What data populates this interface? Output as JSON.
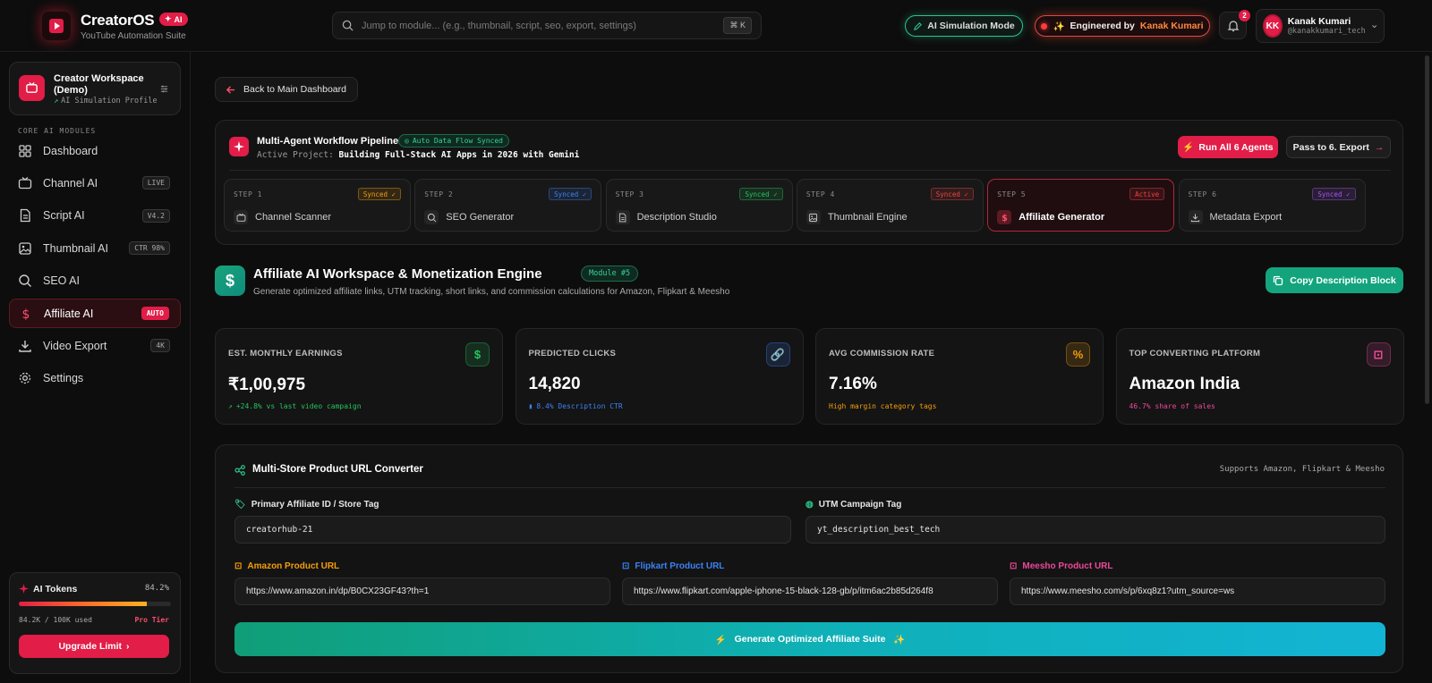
{
  "brand": {
    "title": "CreatorOS",
    "badge": "AI",
    "subtitle": "YouTube Automation Suite"
  },
  "search": {
    "placeholder": "Jump to module... (e.g., thumbnail, script, seo, export, settings)",
    "shortcut": "⌘ K"
  },
  "header": {
    "sim_mode": "AI Simulation Mode",
    "engineered_prefix": "Engineered by",
    "engineered_name": "Kanak Kumari",
    "notif_count": "2"
  },
  "user": {
    "name": "Kanak Kumari",
    "handle": "@kanakkumari_tech",
    "initials": "KK"
  },
  "workspace": {
    "name": "Creator Workspace (Demo)",
    "profile": "AI Simulation Profile"
  },
  "sidebar": {
    "section_label": "CORE AI MODULES",
    "items": [
      {
        "label": "Dashboard",
        "tag": "",
        "icon": "grid-icon"
      },
      {
        "label": "Channel AI",
        "tag": "LIVE",
        "icon": "tv-icon"
      },
      {
        "label": "Script AI",
        "tag": "V4.2",
        "icon": "document-icon"
      },
      {
        "label": "Thumbnail AI",
        "tag": "CTR 98%",
        "icon": "image-icon"
      },
      {
        "label": "SEO AI",
        "tag": "",
        "icon": "search-icon"
      },
      {
        "label": "Affiliate AI",
        "tag": "AUTO",
        "icon": "dollar-icon",
        "active": true
      },
      {
        "label": "Video Export",
        "tag": "4K",
        "icon": "download-icon"
      },
      {
        "label": "Settings",
        "tag": "",
        "icon": "gear-icon"
      }
    ]
  },
  "tokens": {
    "title": "AI Tokens",
    "percent_label": "84.2%",
    "percent": 84.2,
    "used": "84.2K / 100K used",
    "tier": "Pro Tier",
    "upgrade": "Upgrade Limit"
  },
  "back_label": "Back to Main Dashboard",
  "pipeline": {
    "title": "Multi-Agent Workflow Pipeline",
    "flow_badge": "Auto Data Flow Synced",
    "project_prefix": "Active Project:",
    "project": "Building Full-Stack AI Apps in 2026 with Gemini",
    "run_all": "Run All 6 Agents",
    "pass_to": "Pass to 6. Export",
    "steps": [
      {
        "num": "STEP 1",
        "status": "Synced ✓",
        "label": "Channel Scanner",
        "color": "#f59e0b"
      },
      {
        "num": "STEP 2",
        "status": "Synced ✓",
        "label": "SEO Generator",
        "color": "#3b82f6"
      },
      {
        "num": "STEP 3",
        "status": "Synced ✓",
        "label": "Description Studio",
        "color": "#22c55e"
      },
      {
        "num": "STEP 4",
        "status": "Synced ✓",
        "label": "Thumbnail Engine",
        "color": "#ef4444"
      },
      {
        "num": "STEP 5",
        "status": "Active",
        "label": "Affiliate Generator",
        "color": "#ef4444",
        "active": true
      },
      {
        "num": "STEP 6",
        "status": "Synced ✓",
        "label": "Metadata Export",
        "color": "#a855f7"
      }
    ]
  },
  "module": {
    "title": "Affiliate AI Workspace & Monetization Engine",
    "badge": "Module #5",
    "subtitle": "Generate optimized affiliate links, UTM tracking, short links, and commission calculations for Amazon, Flipkart & Meesho",
    "copy_btn": "Copy Description Block"
  },
  "stats": [
    {
      "label": "EST. MONTHLY EARNINGS",
      "value": "₹1,00,975",
      "note": "+24.8% vs last video campaign",
      "color": "#22c55e"
    },
    {
      "label": "PREDICTED CLICKS",
      "value": "14,820",
      "note": "8.4% Description CTR",
      "color": "#3b82f6"
    },
    {
      "label": "AVG COMMISSION RATE",
      "value": "7.16%",
      "note": "High margin category tags",
      "color": "#f59e0b"
    },
    {
      "label": "TOP CONVERTING PLATFORM",
      "value": "Amazon India",
      "note": "46.7% share of sales",
      "color": "#ec4899"
    }
  ],
  "converter": {
    "title": "Multi-Store Product URL Converter",
    "supports": "Supports Amazon, Flipkart & Meesho",
    "affiliate_label": "Primary Affiliate ID / Store Tag",
    "affiliate_value": "creatorhub-21",
    "utm_label": "UTM Campaign Tag",
    "utm_value": "yt_description_best_tech",
    "amazon_label": "Amazon Product URL",
    "amazon_value": "https://www.amazon.in/dp/B0CX23GF43?th=1",
    "flipkart_label": "Flipkart Product URL",
    "flipkart_value": "https://www.flipkart.com/apple-iphone-15-black-128-gb/p/itm6ac2b85d264f8",
    "meesho_label": "Meesho Product URL",
    "meesho_value": "https://www.meesho.com/s/p/6xq8z1?utm_source=ws",
    "generate": "Generate Optimized Affiliate Suite"
  }
}
